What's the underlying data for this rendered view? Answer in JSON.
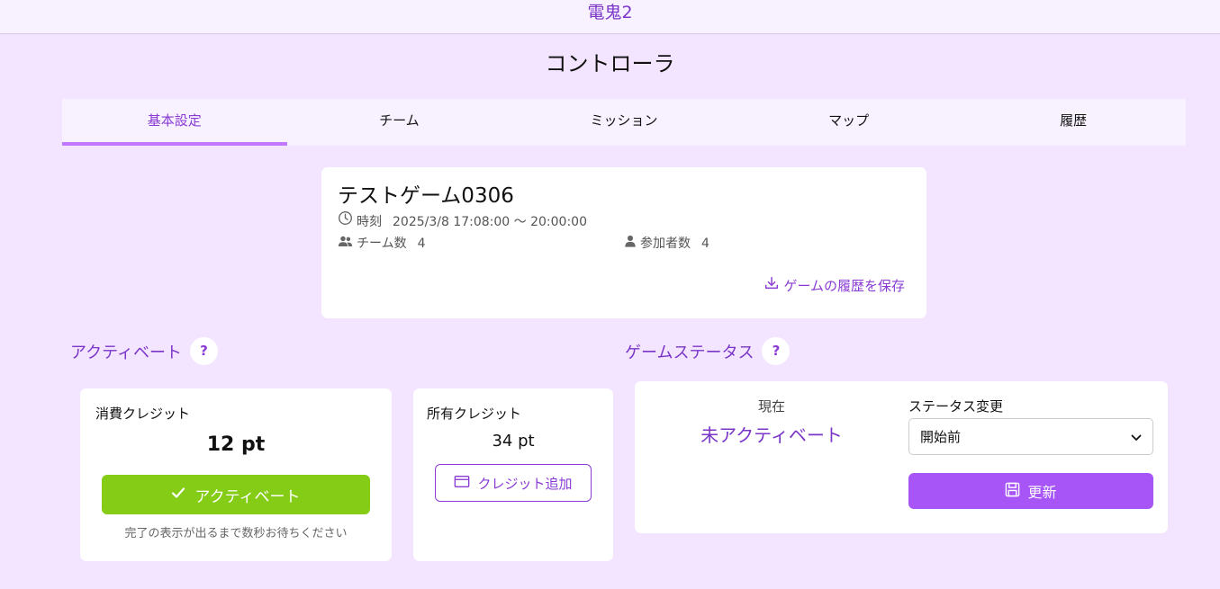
{
  "app": {
    "title": "電鬼2"
  },
  "page": {
    "title": "コントローラ"
  },
  "tabs": [
    {
      "label": "基本設定",
      "active": true
    },
    {
      "label": "チーム"
    },
    {
      "label": "ミッション"
    },
    {
      "label": "マップ"
    },
    {
      "label": "履歴"
    }
  ],
  "game": {
    "name": "テストゲーム0306",
    "time_label": "時刻",
    "time_value": "2025/3/8 17:08:00 〜 20:00:00",
    "teams_label": "チーム数",
    "teams_value": "4",
    "participants_label": "参加者数",
    "participants_value": "4",
    "save_history_label": "ゲームの履歴を保存"
  },
  "activate": {
    "heading": "アクティベート",
    "help": "?",
    "consume_label": "消費クレジット",
    "consume_value": "12 pt",
    "button_label": "アクティベート",
    "note": "完了の表示が出るまで数秒お待ちください",
    "own_label": "所有クレジット",
    "own_value": "34 pt",
    "add_credit_label": "クレジット追加"
  },
  "status": {
    "heading": "ゲームステータス",
    "help": "?",
    "current_label": "現在",
    "current_value": "未アクティベート",
    "change_label": "ステータス変更",
    "selected_option": "開始前",
    "update_label": "更新"
  },
  "colors": {
    "background": "#f3e5ff",
    "accent": "#8a3bd4",
    "activate_green": "#84cc16",
    "update_purple": "#a855f7"
  }
}
